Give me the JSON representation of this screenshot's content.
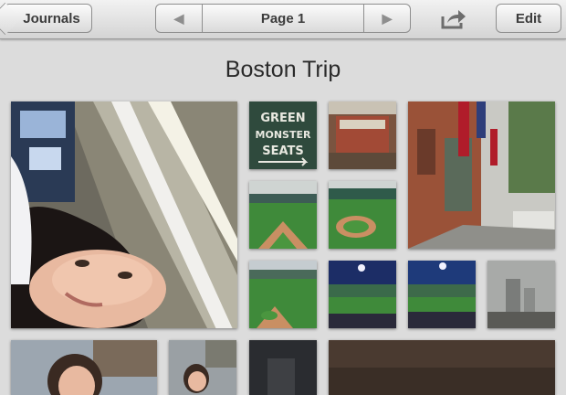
{
  "toolbar": {
    "back_label": "Journals",
    "prev_glyph": "◀",
    "page_label": "Page 1",
    "next_glyph": "▶",
    "share_icon": "share-arrow-icon",
    "edit_label": "Edit"
  },
  "album": {
    "title": "Boston Trip",
    "sign_text": [
      "GREEN",
      "MONSTER",
      "SEATS"
    ]
  },
  "colors": {
    "background": "#dcdcdc",
    "field_green": "#3f8a3a",
    "infield_dirt": "#c98f63",
    "night_sky": "#1c2d66"
  }
}
